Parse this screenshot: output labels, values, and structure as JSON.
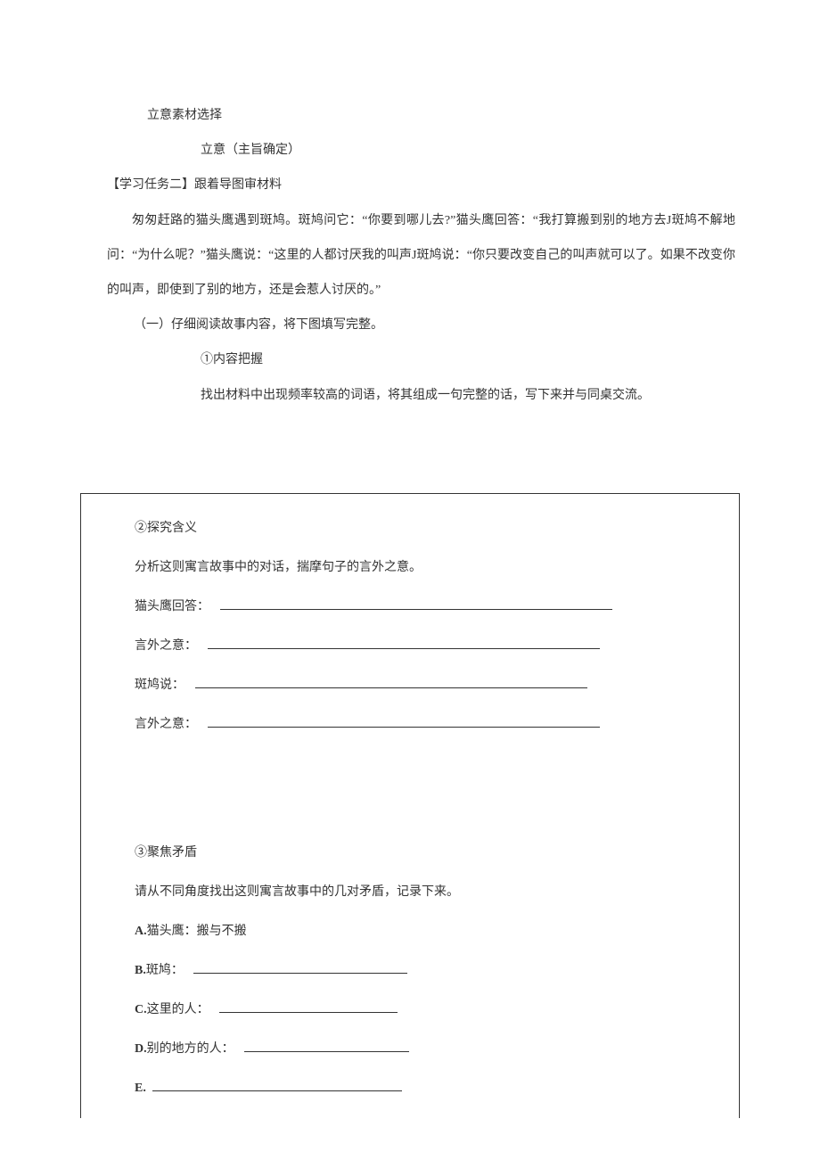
{
  "title_line1": "立意素材选择",
  "title_line2": "立意（主旨确定）",
  "task_header": "【学习任务二】跟着导图审材料",
  "story_paragraph": "匆匆赶路的猫头鹰遇到斑鸠。斑鸠问它：“你要到哪儿去?”猫头鹰回答：“我打算搬到别的地方去J斑鸠不解地问：“为什么呢？”猫头鹰说：“这里的人都讨厌我的叫声J斑鸠说：“你只要改变自己的叫声就可以了。如果不改变你的叫声，即使到了别的地方，还是会惹人讨厌的。”",
  "section_one": "（一）仔细阅读故事内容，将下图填写完整。",
  "step1_title": "①内容把握",
  "step1_instruction": "找出材料中出现频率较高的词语，将其组成一句完整的话，写下来并与同桌交流。",
  "box": {
    "step2_title": "②探究含义",
    "step2_instruction": "分析这则寓言故事中的对话，揣摩句子的言外之意。",
    "owl_answer_label": "猫头鹰回答：",
    "implication_label": "言外之意：",
    "dove_says_label": "斑鸠说：",
    "implication_label2": "言外之意：",
    "step3_title": "③聚焦矛盾",
    "step3_instruction": "请从不同角度找出这则寓言故事中的几对矛盾，记录下来。",
    "item_a_prefix": "A.",
    "item_a_text": "猫头鹰：搬与不搬",
    "item_b_prefix": "B.",
    "item_b_text": "斑鸠：",
    "item_c_prefix": "C.",
    "item_c_text": "这里的人：",
    "item_d_prefix": "D.",
    "item_d_text": "别的地方的人：",
    "item_e_prefix": "E."
  }
}
